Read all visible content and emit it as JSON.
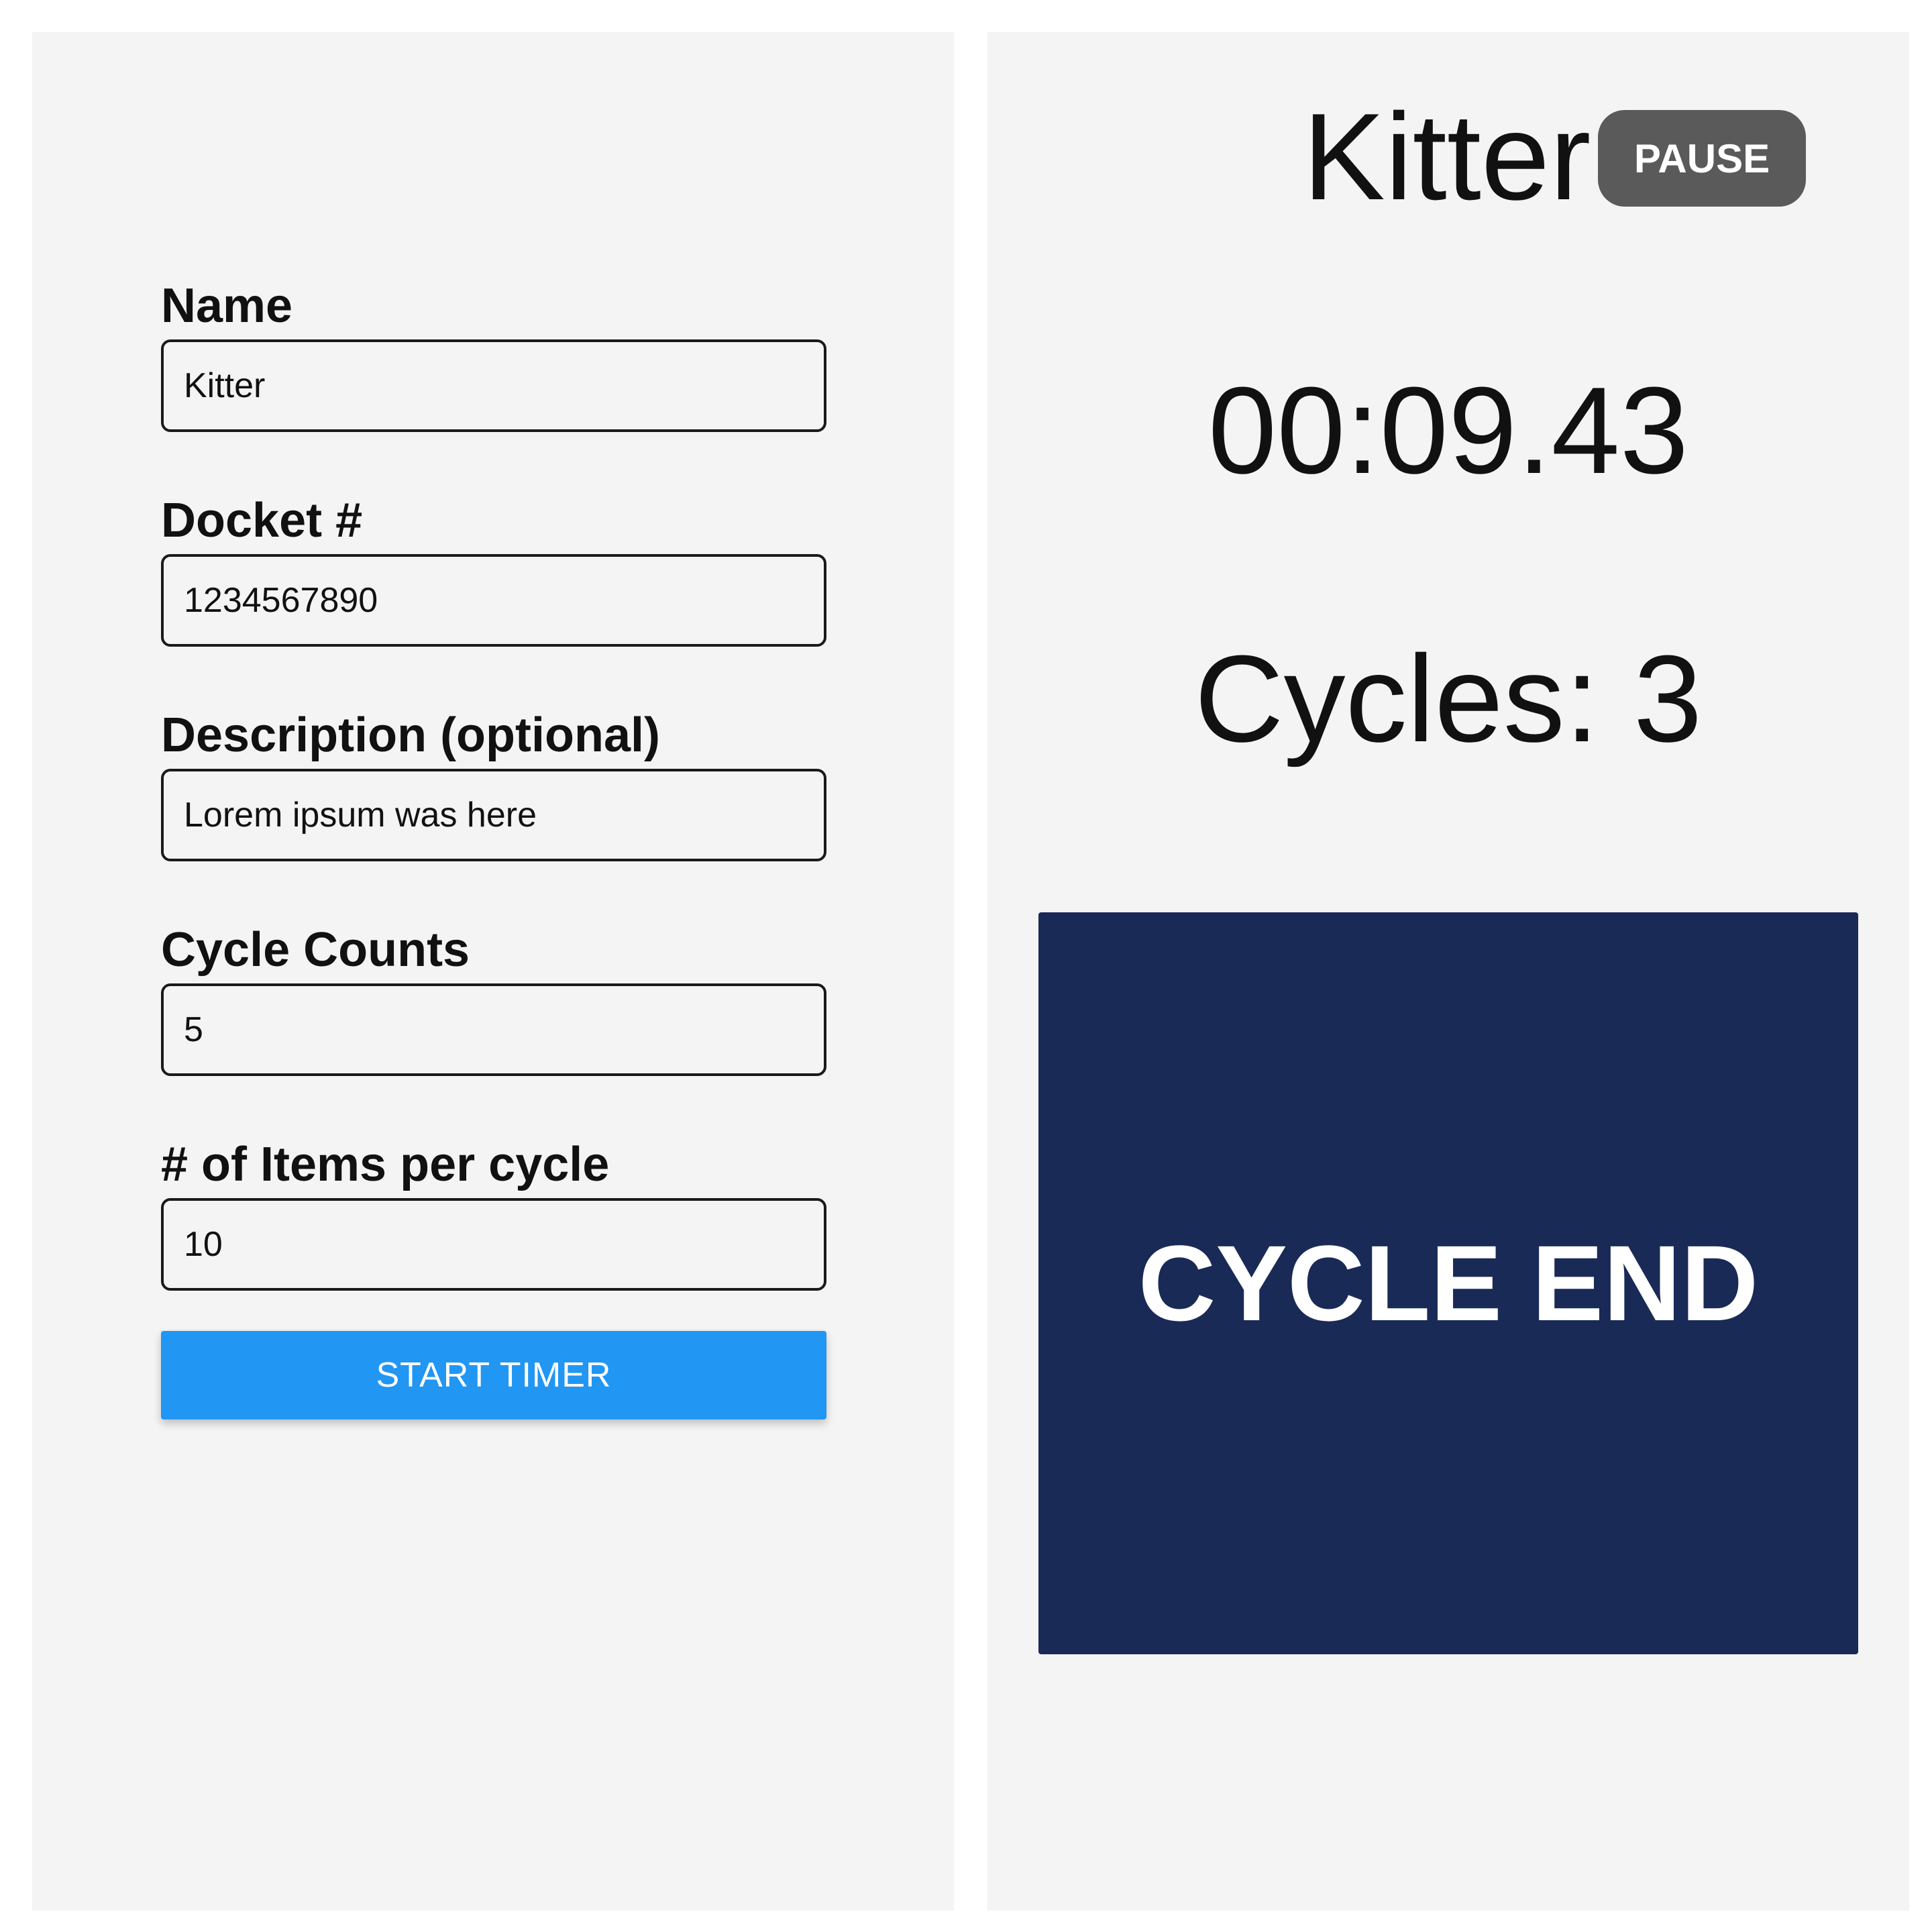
{
  "form": {
    "name_label": "Name",
    "name_value": "Kitter",
    "docket_label": "Docket #",
    "docket_value": "1234567890",
    "description_label": "Description (optional)",
    "description_value": "Lorem ipsum was here",
    "cycle_counts_label": "Cycle Counts",
    "cycle_counts_value": "5",
    "items_per_cycle_label": "# of Items per cycle",
    "items_per_cycle_value": "10",
    "start_button_label": "START TIMER"
  },
  "timer": {
    "name": "Kitter",
    "pause_label": "PAUSE",
    "elapsed": "00:09.43",
    "cycles_prefix": "Cycles:",
    "cycles_count": "3",
    "cycle_end_label": "CYCLE END"
  },
  "colors": {
    "panel_background": "#f4f4f4",
    "primary_button": "#2196f3",
    "pause_button": "#5a5a5a",
    "cycle_end_button": "#1a2a56"
  }
}
